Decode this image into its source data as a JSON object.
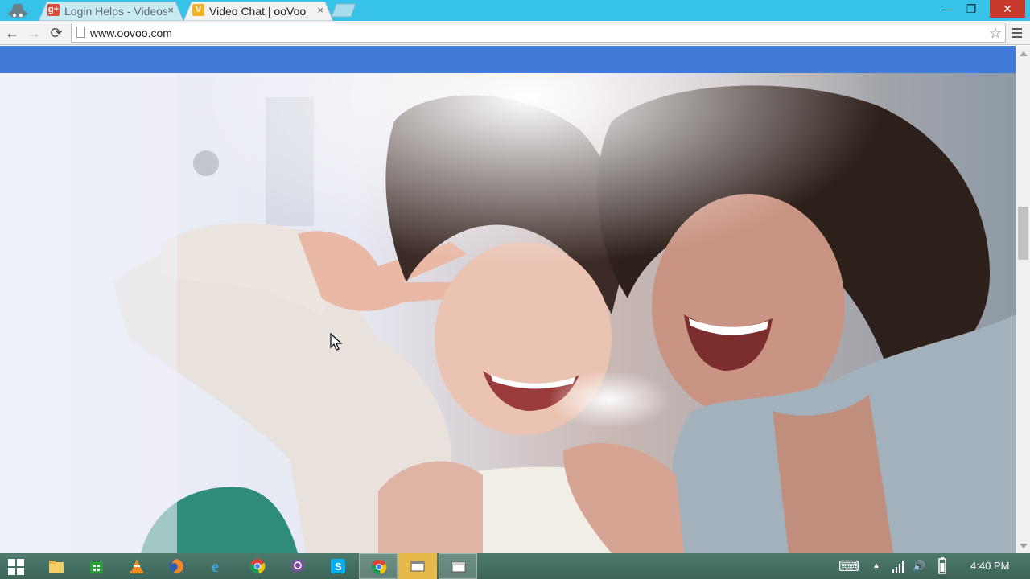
{
  "browser": {
    "tabs": [
      {
        "title": "Login Helps - Videos",
        "favicon": "google-plus-icon",
        "favicon_letter": "g+",
        "favicon_color": "#dd4b39",
        "active": false
      },
      {
        "title": "Video Chat | ooVoo",
        "favicon": "oovoo-icon",
        "favicon_letter": "V",
        "favicon_color": "#f3b321",
        "active": true
      }
    ],
    "close_glyph": "×",
    "window_controls": {
      "minimize": "—",
      "maximize": "❐",
      "close": "✕"
    },
    "address": "www.oovoo.com",
    "nav": {
      "back": "←",
      "forward": "→",
      "reload": "⟳",
      "star": "☆"
    }
  },
  "colors": {
    "tabstrip": "#37c2e9",
    "site_header": "#3f7ad9",
    "taskbar": "#446e62"
  },
  "taskbar": {
    "apps": [
      "file-explorer-icon",
      "store-icon",
      "vlc-icon",
      "firefox-icon",
      "internet-explorer-icon",
      "chrome-icon",
      "viber-icon",
      "skype-icon",
      "chrome-active-icon",
      "window-app-icon",
      "window-app-icon-2"
    ],
    "tray": {
      "keyboard": "⌨",
      "show_hidden": "▲",
      "signal": "signal-icon",
      "volume": "🔊",
      "battery": "battery-icon"
    },
    "time": "4:40 PM"
  }
}
